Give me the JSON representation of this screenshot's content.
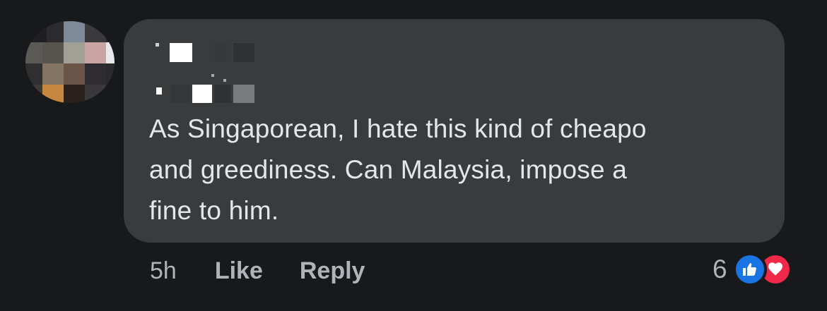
{
  "comment": {
    "text": "As Singaporean, I hate this kind of cheapo\nand greediness. Can Malaysia, impose a\nfine to him.",
    "time": "5h",
    "like_label": "Like",
    "reply_label": "Reply",
    "reaction_count": "6",
    "reactions": [
      "like-icon",
      "love-icon"
    ]
  },
  "colors": {
    "background": "#18191a",
    "bubble": "#3a3b3c",
    "text": "#e4e6eb",
    "secondary_text": "#b0b3b8",
    "like_blue": "#1b74e4",
    "love_red": "#f02849"
  }
}
